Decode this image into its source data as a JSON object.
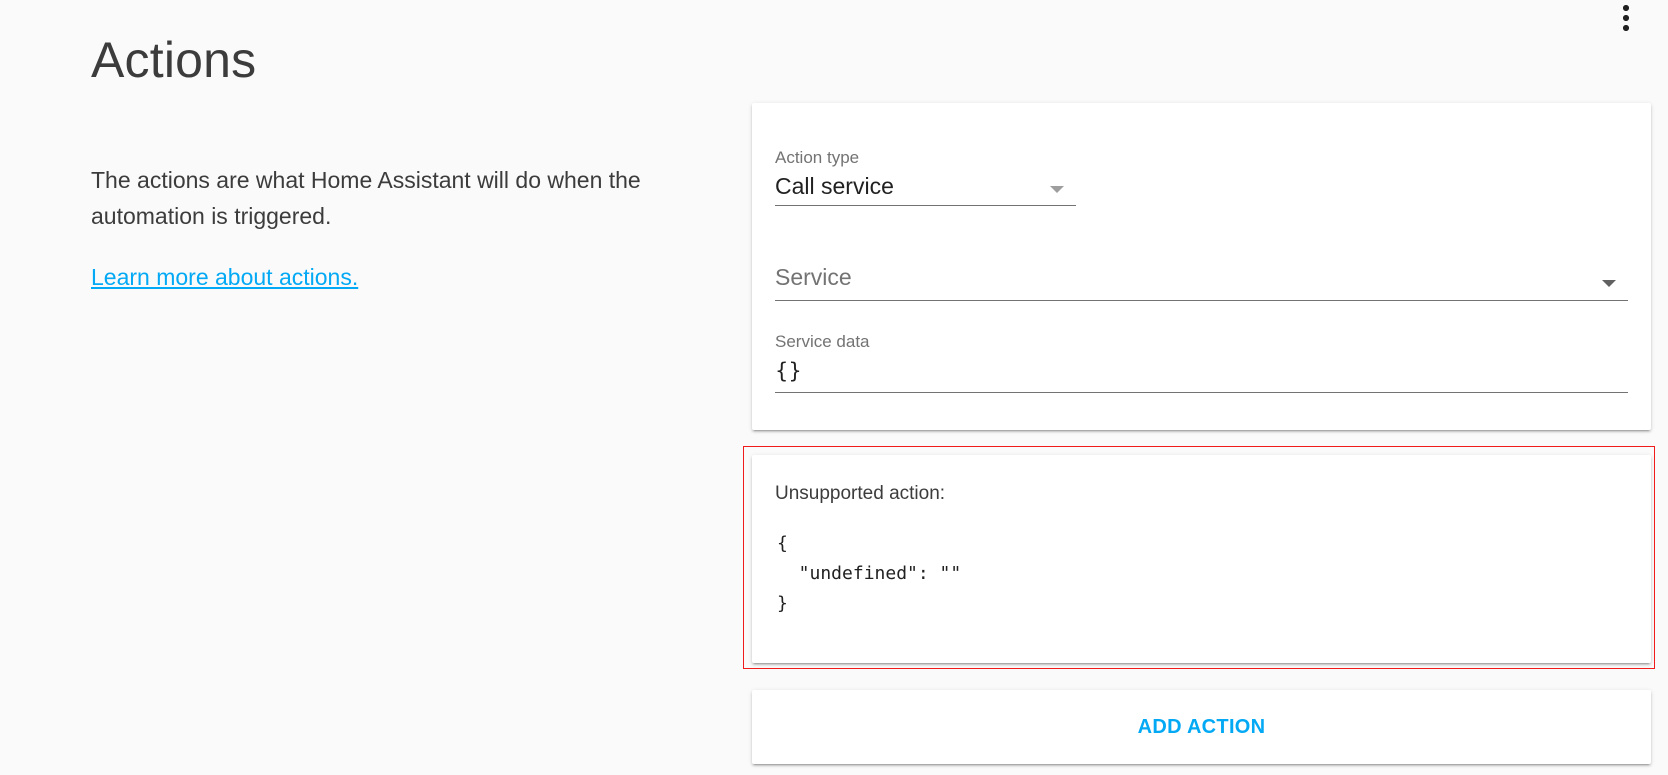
{
  "section": {
    "title": "Actions",
    "description": "The actions are what Home Assistant will do when the automation is triggered.",
    "learn_more_link": "Learn more about actions."
  },
  "action_card": {
    "action_type": {
      "label": "Action type",
      "value": "Call service"
    },
    "service": {
      "placeholder": "Service"
    },
    "service_data": {
      "label": "Service data",
      "value": "{}"
    },
    "menu_icon": "more-vertical-icon"
  },
  "unsupported_card": {
    "title": "Unsupported action:",
    "code": "{\n  \"undefined\": \"\"\n}",
    "menu_icon": "more-vertical-icon",
    "outline_color": "#ee1c1c"
  },
  "add_action": {
    "label": "ADD ACTION"
  },
  "colors": {
    "accent": "#03a9f4",
    "background": "#fafafa",
    "card": "#ffffff",
    "secondary_text": "#737373"
  }
}
